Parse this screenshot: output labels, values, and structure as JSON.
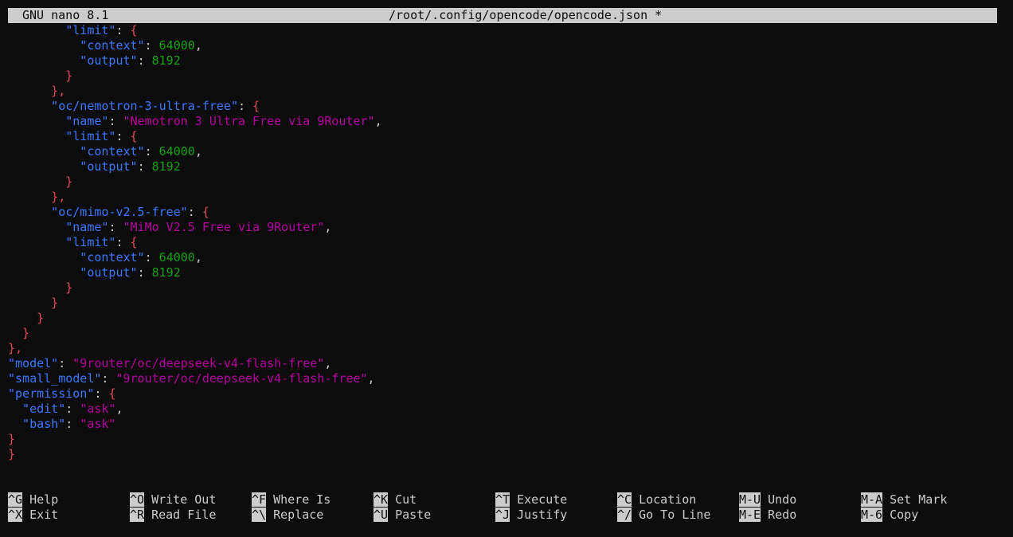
{
  "titlebar": {
    "app": "GNU nano 8.1",
    "file": "/root/.config/opencode/opencode.json *"
  },
  "editor_lines": [
    [
      [
        "k",
        "        \"limit\""
      ],
      [
        "t",
        ": "
      ],
      [
        "p",
        "{"
      ]
    ],
    [
      [
        "k",
        "          \"context\""
      ],
      [
        "t",
        ": "
      ],
      [
        "n",
        "64000"
      ],
      [
        "t",
        ","
      ]
    ],
    [
      [
        "k",
        "          \"output\""
      ],
      [
        "t",
        ": "
      ],
      [
        "n",
        "8192"
      ]
    ],
    [
      [
        "p",
        "        }"
      ]
    ],
    [
      [
        "p",
        "      },"
      ]
    ],
    [
      [
        "k",
        "      \"oc/nemotron-3-ultra-free\""
      ],
      [
        "t",
        ": "
      ],
      [
        "p",
        "{"
      ]
    ],
    [
      [
        "k",
        "        \"name\""
      ],
      [
        "t",
        ": "
      ],
      [
        "s",
        "\"Nemotron 3 Ultra Free via 9Router\""
      ],
      [
        "t",
        ","
      ]
    ],
    [
      [
        "k",
        "        \"limit\""
      ],
      [
        "t",
        ": "
      ],
      [
        "p",
        "{"
      ]
    ],
    [
      [
        "k",
        "          \"context\""
      ],
      [
        "t",
        ": "
      ],
      [
        "n",
        "64000"
      ],
      [
        "t",
        ","
      ]
    ],
    [
      [
        "k",
        "          \"output\""
      ],
      [
        "t",
        ": "
      ],
      [
        "n",
        "8192"
      ]
    ],
    [
      [
        "p",
        "        }"
      ]
    ],
    [
      [
        "p",
        "      },"
      ]
    ],
    [
      [
        "k",
        "      \"oc/mimo-v2.5-free\""
      ],
      [
        "t",
        ": "
      ],
      [
        "p",
        "{"
      ]
    ],
    [
      [
        "k",
        "        \"name\""
      ],
      [
        "t",
        ": "
      ],
      [
        "s",
        "\"MiMo V2.5 Free via 9Router\""
      ],
      [
        "t",
        ","
      ]
    ],
    [
      [
        "k",
        "        \"limit\""
      ],
      [
        "t",
        ": "
      ],
      [
        "p",
        "{"
      ]
    ],
    [
      [
        "k",
        "          \"context\""
      ],
      [
        "t",
        ": "
      ],
      [
        "n",
        "64000"
      ],
      [
        "t",
        ","
      ]
    ],
    [
      [
        "k",
        "          \"output\""
      ],
      [
        "t",
        ": "
      ],
      [
        "n",
        "8192"
      ]
    ],
    [
      [
        "p",
        "        }"
      ]
    ],
    [
      [
        "p",
        "      }"
      ]
    ],
    [
      [
        "p",
        "    }"
      ]
    ],
    [
      [
        "p",
        "  }"
      ]
    ],
    [
      [
        "p",
        "},"
      ]
    ],
    [
      [
        "k",
        "\"model\""
      ],
      [
        "t",
        ": "
      ],
      [
        "s",
        "\"9router/oc/deepseek-v4-flash-free\""
      ],
      [
        "t",
        ","
      ]
    ],
    [
      [
        "k",
        "\"small_model\""
      ],
      [
        "t",
        ": "
      ],
      [
        "s",
        "\"9router/oc/deepseek-v4-flash-free\""
      ],
      [
        "t",
        ","
      ]
    ],
    [
      [
        "k",
        "\"permission\""
      ],
      [
        "t",
        ": "
      ],
      [
        "p",
        "{"
      ]
    ],
    [
      [
        "k",
        "  \"edit\""
      ],
      [
        "t",
        ": "
      ],
      [
        "s",
        "\"ask\""
      ],
      [
        "t",
        ","
      ]
    ],
    [
      [
        "k",
        "  \"bash\""
      ],
      [
        "t",
        ": "
      ],
      [
        "s",
        "\"ask\""
      ]
    ],
    [
      [
        "p",
        "}"
      ]
    ],
    [
      [
        "p",
        "}"
      ]
    ]
  ],
  "shortcuts": {
    "row1": [
      {
        "key": "^G",
        "label": "Help"
      },
      {
        "key": "^O",
        "label": "Write Out"
      },
      {
        "key": "^F",
        "label": "Where Is"
      },
      {
        "key": "^K",
        "label": "Cut"
      },
      {
        "key": "^T",
        "label": "Execute"
      },
      {
        "key": "^C",
        "label": "Location"
      },
      {
        "key": "M-U",
        "label": "Undo"
      },
      {
        "key": "M-A",
        "label": "Set Mark"
      }
    ],
    "row2": [
      {
        "key": "^X",
        "label": "Exit"
      },
      {
        "key": "^R",
        "label": "Read File"
      },
      {
        "key": "^\\",
        "label": "Replace"
      },
      {
        "key": "^U",
        "label": "Paste"
      },
      {
        "key": "^J",
        "label": "Justify"
      },
      {
        "key": "^/",
        "label": "Go To Line"
      },
      {
        "key": "M-E",
        "label": "Redo"
      },
      {
        "key": "M-6",
        "label": "Copy"
      }
    ]
  },
  "colors": {
    "background": "#0c0c0c",
    "key": "#3b78ff",
    "string": "#b4009e",
    "number": "#13a10e",
    "punctuation": "#e74856",
    "text": "#cccccc"
  }
}
